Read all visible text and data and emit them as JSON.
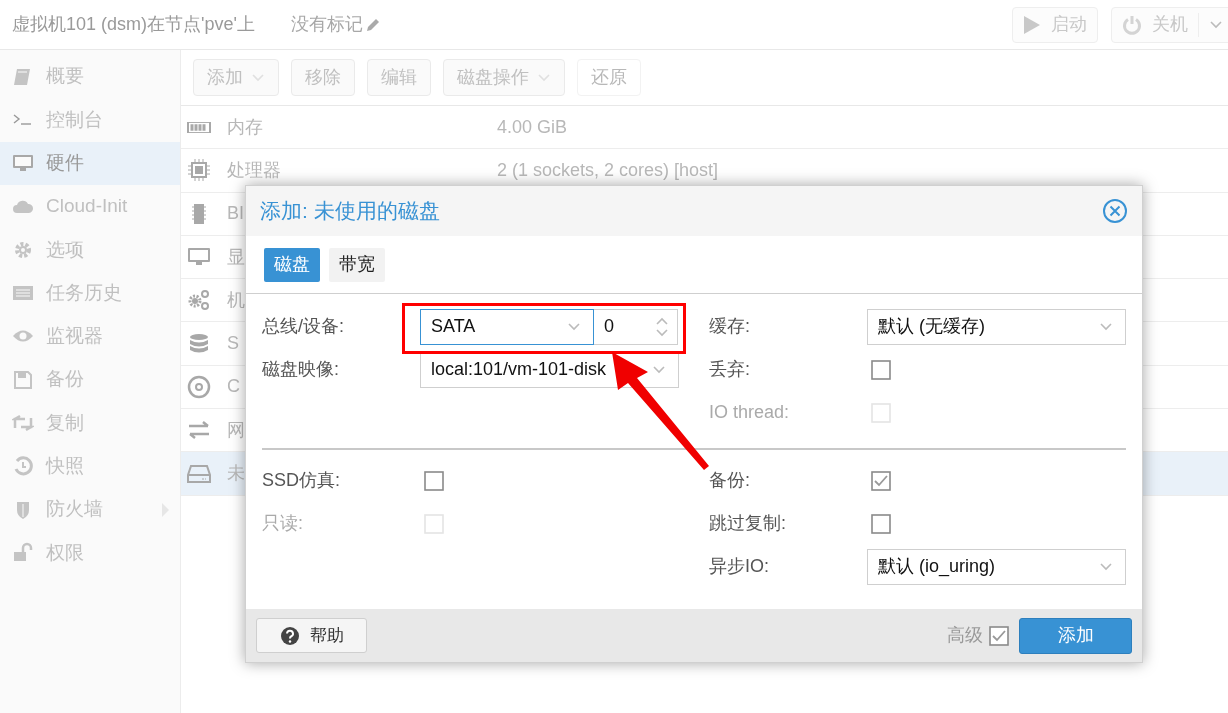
{
  "header": {
    "title": "虚拟机101 (dsm)在节点'pve'上",
    "tags": "没有标记",
    "buttons": [
      {
        "label": "启动",
        "kind": "start"
      },
      {
        "label": "关机",
        "kind": "shutdown"
      }
    ]
  },
  "sidebar": {
    "items": [
      {
        "label": "概要",
        "selected": false
      },
      {
        "label": "控制台",
        "selected": false
      },
      {
        "label": "硬件",
        "selected": true
      },
      {
        "label": "Cloud-Init",
        "selected": false
      },
      {
        "label": "选项",
        "selected": false
      },
      {
        "label": "任务历史",
        "selected": false
      },
      {
        "label": "监视器",
        "selected": false
      },
      {
        "label": "备份",
        "selected": false
      },
      {
        "label": "复制",
        "selected": false
      },
      {
        "label": "快照",
        "selected": false
      },
      {
        "label": "防火墙",
        "selected": false,
        "expanded": false
      },
      {
        "label": "权限",
        "selected": false
      }
    ]
  },
  "toolbar": [
    {
      "label": "添加",
      "dropdown": true,
      "disabled": false
    },
    {
      "label": "移除",
      "dropdown": false,
      "disabled": false
    },
    {
      "label": "编辑",
      "dropdown": false,
      "disabled": false
    },
    {
      "label": "磁盘操作",
      "dropdown": true,
      "disabled": false
    },
    {
      "label": "还原",
      "dropdown": false,
      "disabled": true
    }
  ],
  "hardware": [
    {
      "name": "内存",
      "value": "4.00 GiB",
      "selected": false
    },
    {
      "name": "处理器",
      "value": "2 (1 sockets, 2 cores) [host]",
      "selected": false
    },
    {
      "name": "BI",
      "selected": false
    },
    {
      "name": "显",
      "selected": false
    },
    {
      "name": "机",
      "selected": false
    },
    {
      "name": "S",
      "selected": false
    },
    {
      "name": "C",
      "selected": false
    },
    {
      "name": "网",
      "selected": false
    },
    {
      "name": "未",
      "selected": true
    }
  ],
  "dialog": {
    "title": "添加: 未使用的磁盘",
    "tabs": [
      {
        "label": "磁盘",
        "selected": true
      },
      {
        "label": "带宽",
        "selected": false
      }
    ],
    "upper_left": [
      {
        "kind": "select-spin",
        "label": "总线/设备:",
        "value": "SATA",
        "spin": "0",
        "highlighted": true
      },
      {
        "kind": "select",
        "label": "磁盘映像:",
        "value": "local:101/vm-101-disk"
      }
    ],
    "upper_right": [
      {
        "kind": "select",
        "label": "缓存:",
        "value": "默认 (无缓存)"
      },
      {
        "kind": "checkbox",
        "label": "丢弃:",
        "checked": false,
        "disabled": false
      },
      {
        "kind": "checkbox",
        "label": "IO thread:",
        "checked": false,
        "disabled": true
      }
    ],
    "lower_left": [
      {
        "kind": "checkbox",
        "label": "SSD仿真:",
        "checked": false,
        "disabled": false
      },
      {
        "kind": "checkbox",
        "label": "只读:",
        "checked": false,
        "disabled": true
      }
    ],
    "lower_right": [
      {
        "kind": "checkbox",
        "label": "备份:",
        "checked": true,
        "disabled": false
      },
      {
        "kind": "checkbox",
        "label": "跳过复制:",
        "checked": false,
        "disabled": false
      },
      {
        "kind": "select",
        "label": "异步IO:",
        "value": "默认 (io_uring)"
      }
    ],
    "help": "帮助",
    "advanced": {
      "label": "高级",
      "checked": true
    },
    "submit": "添加"
  }
}
